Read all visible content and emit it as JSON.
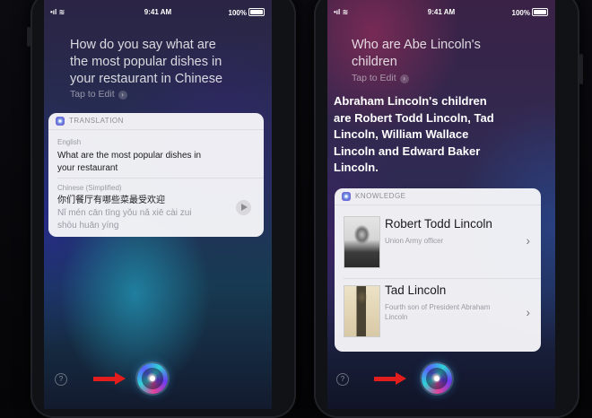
{
  "status_bar": {
    "time": "9:41 AM",
    "battery": "100%"
  },
  "left": {
    "query": [
      "How do you say what are",
      "the most popular dishes in",
      "your restaurant in Chinese"
    ],
    "tap_to_edit": "Tap to Edit",
    "card_title": "TRANSLATION",
    "source_lang": "English",
    "source_text": [
      "What are the most popular dishes in",
      "your restaurant"
    ],
    "target_lang": "Chinese (Simplified)",
    "target_text": "你们餐厅有哪些菜最受欢迎",
    "pinyin": [
      "Nǐ mén cān tīng yǒu nǎ xiē cài zui",
      "shòu huān yíng"
    ]
  },
  "right": {
    "query": [
      "Who are Abe Lincoln's",
      "children"
    ],
    "tap_to_edit": "Tap to Edit",
    "answer": [
      "Abraham Lincoln's children",
      "are Robert Todd Lincoln, Tad",
      "Lincoln, William Wallace",
      "Lincoln and Edward Baker",
      "Lincoln."
    ],
    "card_title": "KNOWLEDGE",
    "people": [
      {
        "name": "Robert Todd Lincoln",
        "desc": [
          "Union Army officer"
        ]
      },
      {
        "name": "Tad Lincoln",
        "desc": [
          "Fourth son of President Abraham",
          "Lincoln"
        ]
      }
    ]
  },
  "icons": {
    "help": "?",
    "chevron": "›"
  },
  "colors": {
    "annotation_arrow": "#e31c1c"
  }
}
